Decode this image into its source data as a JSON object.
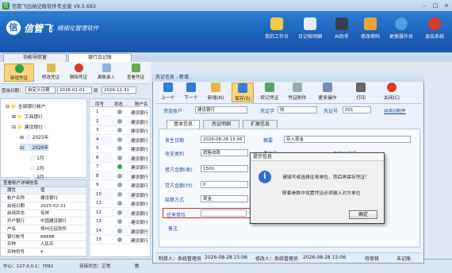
{
  "window": {
    "title": "信管飞出纳记账软件专业版 V9.5.683"
  },
  "brand": {
    "name": "信管飞",
    "slogan": "精细化管理软件"
  },
  "top_toolbar": [
    {
      "label": "我的工作台",
      "icon": "workbench-icon"
    },
    {
      "label": "日记帐明细",
      "icon": "ledger-detail-icon"
    },
    {
      "label": "AI助手",
      "icon": "ai-assistant-icon"
    },
    {
      "label": "修改密码",
      "icon": "change-password-icon"
    },
    {
      "label": "更换操作员",
      "icon": "switch-operator-icon"
    },
    {
      "label": "退出系统",
      "icon": "exit-icon"
    }
  ],
  "tabs": [
    {
      "label": "功能导航窗"
    },
    {
      "label": "银行日记账"
    }
  ],
  "left_toolbar": [
    {
      "label": "新增凭证"
    },
    {
      "label": "修改凭证"
    },
    {
      "label": "删除凭证"
    },
    {
      "label": "离账录入"
    },
    {
      "label": "查看凭证"
    }
  ],
  "query": {
    "label": "查询日期：",
    "range": "自定义日期",
    "from": "2026-01-01",
    "to_sep": "到",
    "to": "2026-12-31"
  },
  "tree": {
    "root": "全部银行帐户",
    "items": [
      "工商银行",
      "建设银行",
      "2025年",
      "2026年",
      "1月",
      "2月",
      "3月"
    ]
  },
  "grid": {
    "headers": [
      "序号",
      "状态",
      "账户名"
    ],
    "rows": [
      [
        "1",
        "建设银行"
      ],
      [
        "2",
        "建设银行"
      ],
      [
        "3",
        "建设银行"
      ],
      [
        "4",
        "建设银行"
      ],
      [
        "5",
        "建设银行"
      ],
      [
        "6",
        "建设银行"
      ],
      [
        "7",
        "建设银行"
      ],
      [
        "8",
        "建设银行"
      ],
      [
        "9",
        "建设银行"
      ],
      [
        "10",
        "建设银行"
      ],
      [
        "11",
        "建设银行"
      ],
      [
        "12",
        "建设银行"
      ],
      [
        "13",
        "建设银行"
      ],
      [
        "14",
        "建设银行"
      ],
      [
        "15",
        "建设银行"
      ]
    ],
    "right_cut": "无本期"
  },
  "properties": {
    "title": "查看帐户详细信息",
    "col_key": "属性",
    "col_val": "值",
    "rows": [
      [
        "帐户名称",
        "建设银行"
      ],
      [
        "启用日期",
        "2025-02-21"
      ],
      [
        "启用状态",
        "有效"
      ],
      [
        "开户银行",
        "中国建设银行"
      ],
      [
        "户名",
        "郑州迁延软件"
      ],
      [
        "银行帐号",
        "88888"
      ],
      [
        "币种",
        "人民币"
      ],
      [
        "币种符号",
        "¥"
      ]
    ]
  },
  "status": {
    "host": "中心：127.0.0.1：7092",
    "conn": "连接状态：正常",
    "cut": "数"
  },
  "voucher": {
    "title": "凭证信息 - 新增",
    "toolbar": [
      "上一个",
      "下一个",
      "新增(N)",
      "保存(S)",
      "转记凭证",
      "凭证附件",
      "更多操作",
      "打印",
      "关闭(C)"
    ],
    "account_label": "资金账户",
    "account": "建设银行",
    "voucher_label": "凭证字",
    "voucher_val": "收",
    "voucher_no_label": "凭证号",
    "voucher_no": "001",
    "related": "共有0附件",
    "tabs": [
      "基本信息",
      "凭证明细",
      "扩展信息"
    ],
    "date_label": "发生日期",
    "date": "2026-08-28 15:06",
    "summary_label": "摘要",
    "summary": "存入现金",
    "type_label": "收支类别",
    "type": "销售收款",
    "ref_label": "票据号",
    "ref2_label": "自定义编号",
    "debit_label": "借方金额(收)",
    "debit": "1500",
    "credit_label": "贷方金额(付)",
    "credit": "0",
    "method_label": "结算方式",
    "method": "现金",
    "unit_label": "往来单位",
    "unit": "",
    "remark_label": "备注",
    "footer": {
      "creator": "制单人：系统管理员",
      "c_time": "2026-08-28 15:06",
      "modifier": "修改人：系统管理员",
      "m_time": "2026-08-28 15:06",
      "audit": "待审核",
      "count": "未记账"
    }
  },
  "dialog": {
    "title": "提示信息",
    "line1": "请填写或选择往来单位，然后再保存凭证！",
    "line2": "账套参数中设置凭证必须输入对方单位",
    "ok": "确定"
  }
}
